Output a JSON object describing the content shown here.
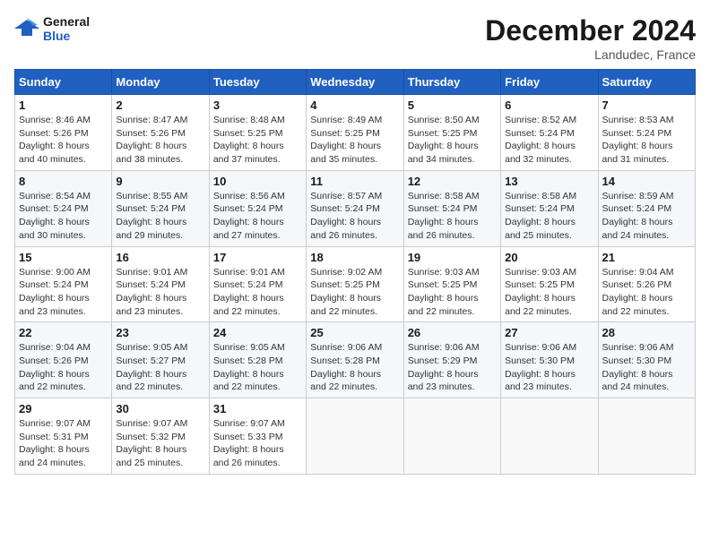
{
  "header": {
    "logo_line1": "General",
    "logo_line2": "Blue",
    "month": "December 2024",
    "location": "Landudec, France"
  },
  "weekdays": [
    "Sunday",
    "Monday",
    "Tuesday",
    "Wednesday",
    "Thursday",
    "Friday",
    "Saturday"
  ],
  "weeks": [
    [
      {
        "day": "1",
        "info": "Sunrise: 8:46 AM\nSunset: 5:26 PM\nDaylight: 8 hours\nand 40 minutes."
      },
      {
        "day": "2",
        "info": "Sunrise: 8:47 AM\nSunset: 5:26 PM\nDaylight: 8 hours\nand 38 minutes."
      },
      {
        "day": "3",
        "info": "Sunrise: 8:48 AM\nSunset: 5:25 PM\nDaylight: 8 hours\nand 37 minutes."
      },
      {
        "day": "4",
        "info": "Sunrise: 8:49 AM\nSunset: 5:25 PM\nDaylight: 8 hours\nand 35 minutes."
      },
      {
        "day": "5",
        "info": "Sunrise: 8:50 AM\nSunset: 5:25 PM\nDaylight: 8 hours\nand 34 minutes."
      },
      {
        "day": "6",
        "info": "Sunrise: 8:52 AM\nSunset: 5:24 PM\nDaylight: 8 hours\nand 32 minutes."
      },
      {
        "day": "7",
        "info": "Sunrise: 8:53 AM\nSunset: 5:24 PM\nDaylight: 8 hours\nand 31 minutes."
      }
    ],
    [
      {
        "day": "8",
        "info": "Sunrise: 8:54 AM\nSunset: 5:24 PM\nDaylight: 8 hours\nand 30 minutes."
      },
      {
        "day": "9",
        "info": "Sunrise: 8:55 AM\nSunset: 5:24 PM\nDaylight: 8 hours\nand 29 minutes."
      },
      {
        "day": "10",
        "info": "Sunrise: 8:56 AM\nSunset: 5:24 PM\nDaylight: 8 hours\nand 27 minutes."
      },
      {
        "day": "11",
        "info": "Sunrise: 8:57 AM\nSunset: 5:24 PM\nDaylight: 8 hours\nand 26 minutes."
      },
      {
        "day": "12",
        "info": "Sunrise: 8:58 AM\nSunset: 5:24 PM\nDaylight: 8 hours\nand 26 minutes."
      },
      {
        "day": "13",
        "info": "Sunrise: 8:58 AM\nSunset: 5:24 PM\nDaylight: 8 hours\nand 25 minutes."
      },
      {
        "day": "14",
        "info": "Sunrise: 8:59 AM\nSunset: 5:24 PM\nDaylight: 8 hours\nand 24 minutes."
      }
    ],
    [
      {
        "day": "15",
        "info": "Sunrise: 9:00 AM\nSunset: 5:24 PM\nDaylight: 8 hours\nand 23 minutes."
      },
      {
        "day": "16",
        "info": "Sunrise: 9:01 AM\nSunset: 5:24 PM\nDaylight: 8 hours\nand 23 minutes."
      },
      {
        "day": "17",
        "info": "Sunrise: 9:01 AM\nSunset: 5:24 PM\nDaylight: 8 hours\nand 22 minutes."
      },
      {
        "day": "18",
        "info": "Sunrise: 9:02 AM\nSunset: 5:25 PM\nDaylight: 8 hours\nand 22 minutes."
      },
      {
        "day": "19",
        "info": "Sunrise: 9:03 AM\nSunset: 5:25 PM\nDaylight: 8 hours\nand 22 minutes."
      },
      {
        "day": "20",
        "info": "Sunrise: 9:03 AM\nSunset: 5:25 PM\nDaylight: 8 hours\nand 22 minutes."
      },
      {
        "day": "21",
        "info": "Sunrise: 9:04 AM\nSunset: 5:26 PM\nDaylight: 8 hours\nand 22 minutes."
      }
    ],
    [
      {
        "day": "22",
        "info": "Sunrise: 9:04 AM\nSunset: 5:26 PM\nDaylight: 8 hours\nand 22 minutes."
      },
      {
        "day": "23",
        "info": "Sunrise: 9:05 AM\nSunset: 5:27 PM\nDaylight: 8 hours\nand 22 minutes."
      },
      {
        "day": "24",
        "info": "Sunrise: 9:05 AM\nSunset: 5:28 PM\nDaylight: 8 hours\nand 22 minutes."
      },
      {
        "day": "25",
        "info": "Sunrise: 9:06 AM\nSunset: 5:28 PM\nDaylight: 8 hours\nand 22 minutes."
      },
      {
        "day": "26",
        "info": "Sunrise: 9:06 AM\nSunset: 5:29 PM\nDaylight: 8 hours\nand 23 minutes."
      },
      {
        "day": "27",
        "info": "Sunrise: 9:06 AM\nSunset: 5:30 PM\nDaylight: 8 hours\nand 23 minutes."
      },
      {
        "day": "28",
        "info": "Sunrise: 9:06 AM\nSunset: 5:30 PM\nDaylight: 8 hours\nand 24 minutes."
      }
    ],
    [
      {
        "day": "29",
        "info": "Sunrise: 9:07 AM\nSunset: 5:31 PM\nDaylight: 8 hours\nand 24 minutes."
      },
      {
        "day": "30",
        "info": "Sunrise: 9:07 AM\nSunset: 5:32 PM\nDaylight: 8 hours\nand 25 minutes."
      },
      {
        "day": "31",
        "info": "Sunrise: 9:07 AM\nSunset: 5:33 PM\nDaylight: 8 hours\nand 26 minutes."
      },
      {
        "day": "",
        "info": ""
      },
      {
        "day": "",
        "info": ""
      },
      {
        "day": "",
        "info": ""
      },
      {
        "day": "",
        "info": ""
      }
    ]
  ]
}
